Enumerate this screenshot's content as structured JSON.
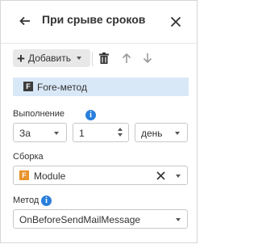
{
  "header": {
    "title": "При срыве сроков",
    "back_icon": "arrow-left-icon",
    "close_icon": "close-icon"
  },
  "toolbar": {
    "add_label": "Добавить",
    "icons": [
      "plus-icon",
      "trash-icon",
      "arrow-up-icon",
      "arrow-down-icon"
    ]
  },
  "list": {
    "items": [
      {
        "label": "Fore-метод",
        "icon": "fore-method-icon",
        "selected": true
      }
    ]
  },
  "execution": {
    "label": "Выполнение",
    "when": "За",
    "amount": "1",
    "unit": "день"
  },
  "assembly": {
    "label": "Сборка",
    "value": "Module"
  },
  "method": {
    "label": "Метод",
    "value": "OnBeforeSendMailMessage"
  },
  "colors": {
    "accent": "#2a7fdc",
    "selection": "#d9e8f7",
    "module_icon": "#e8922c",
    "button_bg": "#e8e8e8",
    "border": "#c8c8c8"
  }
}
